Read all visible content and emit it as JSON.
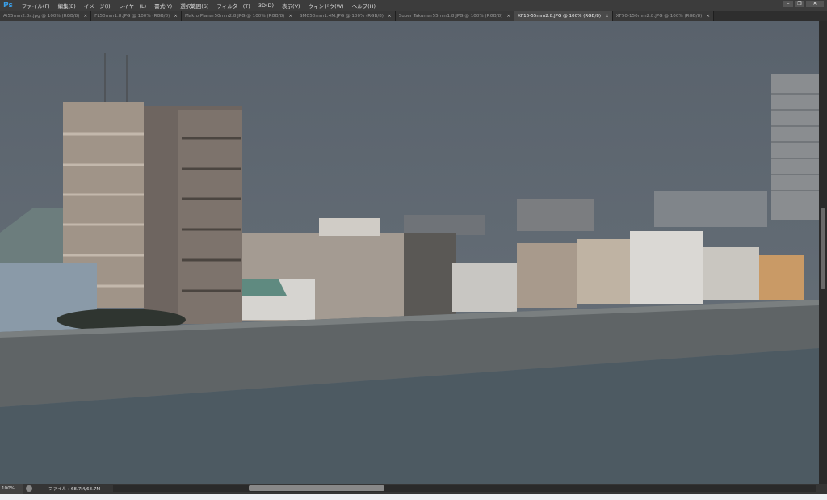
{
  "app": {
    "logo": "Ps"
  },
  "menu": [
    "ファイル(F)",
    "編集(E)",
    "イメージ(I)",
    "レイヤー(L)",
    "書式(Y)",
    "選択範囲(S)",
    "フィルター(T)",
    "3D(D)",
    "表示(V)",
    "ウィンドウ(W)",
    "ヘルプ(H)"
  ],
  "window_controls": {
    "minimize": "–",
    "restore": "❐",
    "close": "✕"
  },
  "tabs": [
    {
      "label": "Ai55mm2.8s.jpg @ 100% (RGB/8)",
      "close": "×"
    },
    {
      "label": "FL50mm1.8.JPG @ 100% (RGB/8)",
      "close": "×"
    },
    {
      "label": "Makro Planar50mm2.8.JPG @ 100% (RGB/8)",
      "close": "×"
    },
    {
      "label": "SMC50mm1.4M.JPG @ 100% (RGB/8)",
      "close": "×"
    },
    {
      "label": "Super Takumar55mm1.8.JPG @ 100% (RGB/8)",
      "close": "×"
    },
    {
      "label": "XF16-55mm2.8.JPG @ 100% (RGB/8)",
      "close": "×",
      "active": true
    },
    {
      "label": "XF50-150mm2.8.JPG @ 100% (RGB/8)",
      "close": "×"
    }
  ],
  "status": {
    "zoom": "100%",
    "doc": "ファイル : 68.7M/68.7M",
    "arrow": "▶"
  }
}
